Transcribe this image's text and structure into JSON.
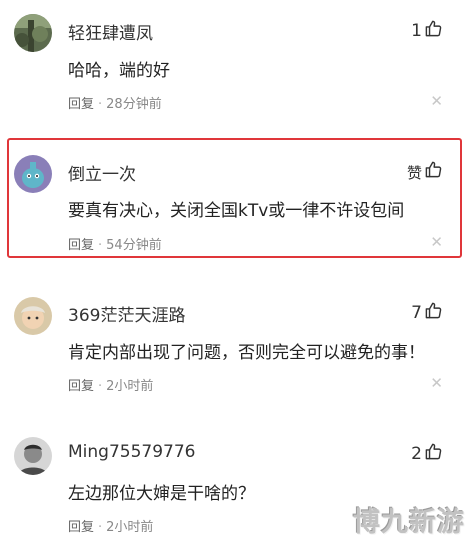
{
  "comments": [
    {
      "username": "轻狂肆遭凤",
      "text": "哈哈，端的好",
      "likes": "1",
      "reply_label": "回复",
      "time": "28分钟前",
      "avatar_icon": "user-avatar-forest"
    },
    {
      "username": "倒立一次",
      "text": "要真有决心，关闭全国kTv或一律不许设包间",
      "likes": "赞",
      "reply_label": "回复",
      "time": "54分钟前",
      "highlighted": true,
      "highlight_color": "#e0363a",
      "avatar_icon": "user-avatar-cartoon"
    },
    {
      "username": "369茫茫天涯路",
      "text": "肯定内部出现了问题，否则完全可以避免的事！",
      "likes": "7",
      "reply_label": "回复",
      "time": "2小时前",
      "avatar_icon": "user-avatar-child"
    },
    {
      "username": "Ming75579776",
      "text": "左边那位大婶是干啥的？",
      "likes": "2",
      "reply_label": "回复",
      "time": "2小时前",
      "avatar_icon": "user-avatar-man"
    }
  ],
  "watermark": "博九新游"
}
